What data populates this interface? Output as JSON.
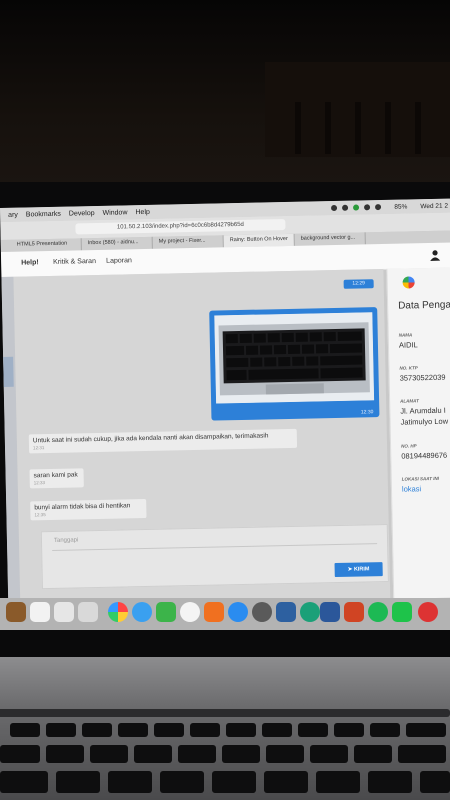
{
  "menubar": {
    "items": [
      "ary",
      "Bookmarks",
      "Develop",
      "Window",
      "Help"
    ],
    "battery": "85%",
    "clock": "Wed 21 2"
  },
  "browser": {
    "url": "101.50.2.103/index.php?id=6c0c6b8d4279b65d",
    "tabs": [
      "HTML5 Presentation",
      "Inbox (580) - aidnu...",
      "My project - Fixer...",
      "Rainy: Button On Hover",
      "background vector g..."
    ]
  },
  "app": {
    "tabs": [
      "Help!",
      "Kritik & Saran",
      "Laporan"
    ]
  },
  "chat": {
    "outgoing_time": "12:29",
    "image_time": "12:30",
    "messages": [
      {
        "text": "Untuk saat ini sudah cukup, jika ada kendala nanti akan disampaikan, terimakasih",
        "time": "12:31"
      },
      {
        "text": "saran kami pak",
        "time": "12:33"
      },
      {
        "text": "bunyi alarm tidak bisa di hentikan",
        "time": "12:35"
      }
    ],
    "input_placeholder": "Tanggapi",
    "send_label": "KIRIM"
  },
  "profile": {
    "title": "Data Penga",
    "fields": [
      {
        "label": "NAMA",
        "value": "AIDIL"
      },
      {
        "label": "NO. KTP",
        "value": "35730522039"
      },
      {
        "label": "ALAMAT",
        "value": "Jl. Arumdalu I",
        "value2": "Jatimulyo Low"
      },
      {
        "label": "NO. HP",
        "value": "08194489676"
      },
      {
        "label": "LOKASI SAAT INI",
        "value": "lokasi"
      }
    ]
  },
  "colors": {
    "accent": "#2d80d8",
    "chat_bg": "#d6d6d6",
    "bubble_in": "#ececec"
  }
}
